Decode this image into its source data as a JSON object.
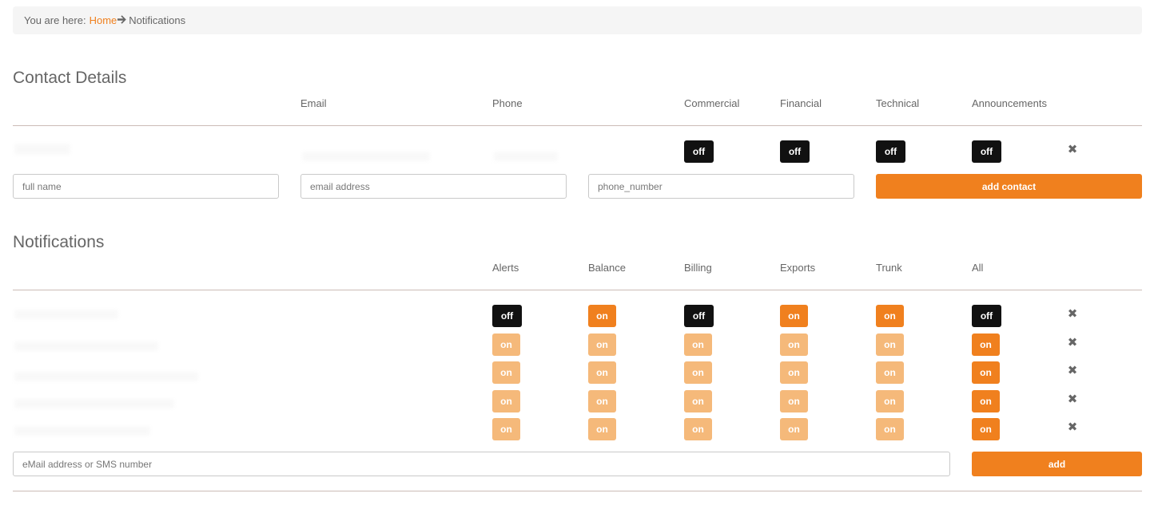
{
  "breadcrumb": {
    "prefix": "You are here:",
    "home": "Home",
    "current": "Notifications"
  },
  "contact": {
    "title": "Contact Details",
    "columns": {
      "email": "Email",
      "phone": "Phone",
      "commercial": "Commercial",
      "financial": "Financial",
      "technical": "Technical",
      "announcements": "Announcements"
    },
    "row": {
      "commercial": "off",
      "financial": "off",
      "technical": "off",
      "announcements": "off"
    },
    "form": {
      "name_placeholder": "full name",
      "email_placeholder": "email address",
      "phone_placeholder": "phone_number",
      "add_label": "add contact"
    }
  },
  "notifications": {
    "title": "Notifications",
    "columns": {
      "alerts": "Alerts",
      "balance": "Balance",
      "billing": "Billing",
      "exports": "Exports",
      "trunk": "Trunk",
      "all": "All"
    },
    "rows": [
      {
        "alerts": "off",
        "balance": "on",
        "billing": "off",
        "exports": "on",
        "trunk": "on",
        "all": "off"
      },
      {
        "alerts": "on",
        "balance": "on",
        "billing": "on",
        "exports": "on",
        "trunk": "on",
        "all": "on"
      },
      {
        "alerts": "on",
        "balance": "on",
        "billing": "on",
        "exports": "on",
        "trunk": "on",
        "all": "on"
      },
      {
        "alerts": "on",
        "balance": "on",
        "billing": "on",
        "exports": "on",
        "trunk": "on",
        "all": "on"
      },
      {
        "alerts": "on",
        "balance": "on",
        "billing": "on",
        "exports": "on",
        "trunk": "on",
        "all": "on"
      }
    ],
    "form": {
      "placeholder": "eMail address or SMS number",
      "add_label": "add"
    }
  },
  "icons": {
    "remove": "close-icon",
    "breadcrumb_arrow": "arrow-right-icon"
  },
  "colors": {
    "accent": "#f0801e",
    "accent_light": "#f5b97a",
    "off": "#111111"
  }
}
